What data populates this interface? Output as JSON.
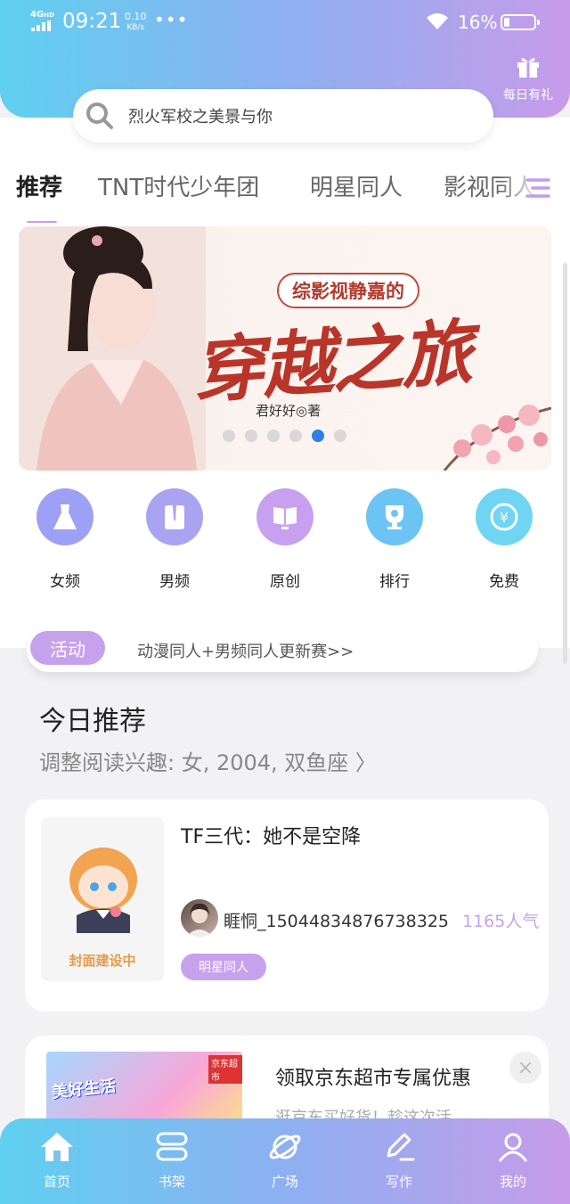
{
  "status_bar": {
    "network": "4G",
    "network_sup": "HD",
    "time": "09:21",
    "speed_value": "0.10",
    "speed_unit": "KB/s",
    "more": "•••",
    "battery": "16%"
  },
  "header": {
    "gift_label": "每日有礼",
    "search_placeholder": "烈火军校之美景与你"
  },
  "tabs": [
    {
      "label": "推荐",
      "active": true
    },
    {
      "label": "TNT时代少年团",
      "active": false
    },
    {
      "label": "明星同人",
      "active": false
    },
    {
      "label": "影视同人",
      "active": false
    }
  ],
  "banner": {
    "subtitle": "综影视静嘉的",
    "title": "穿越之旅",
    "author": "君好好◎著",
    "dot_count": 6,
    "active_dot": 4
  },
  "categories": [
    {
      "label": "女频",
      "icon": "dress-icon",
      "color": "#9ea0f5"
    },
    {
      "label": "男频",
      "icon": "shirt-icon",
      "color": "#a9a3f2"
    },
    {
      "label": "原创",
      "icon": "book-icon",
      "color": "#c8a0f0"
    },
    {
      "label": "排行",
      "icon": "trophy-icon",
      "color": "#6cc4f5"
    },
    {
      "label": "免费",
      "icon": "coin-icon",
      "color": "#6fd5f3"
    }
  ],
  "activity": {
    "tag": "活动",
    "text": "动漫同人+男频同人更新赛>>"
  },
  "today": {
    "title": "今日推荐",
    "subtitle": "调整阅读兴趣: 女, 2004, 双鱼座 〉"
  },
  "book": {
    "cover_caption": "封面建设中",
    "title": "TF三代：她不是空降",
    "author": "睚恫_15044834876738325",
    "popularity": "1165人气",
    "tag": "明星同人"
  },
  "ad": {
    "logo": "京东超市",
    "slogan": "美好生活",
    "title": "领取京东超市专属优惠",
    "desc": "逛京东买好货！趁这次活",
    "close": "×"
  },
  "bottom_nav": [
    {
      "label": "首页",
      "icon": "home-icon"
    },
    {
      "label": "书架",
      "icon": "bookshelf-icon"
    },
    {
      "label": "广场",
      "icon": "planet-icon"
    },
    {
      "label": "写作",
      "icon": "pen-icon"
    },
    {
      "label": "我的",
      "icon": "profile-icon"
    }
  ],
  "colors": {
    "gradient_start": "#5fd0f0",
    "gradient_end": "#c79bea",
    "accent_purple": "#c7a2ec",
    "active_dot": "#2f7fe6"
  }
}
